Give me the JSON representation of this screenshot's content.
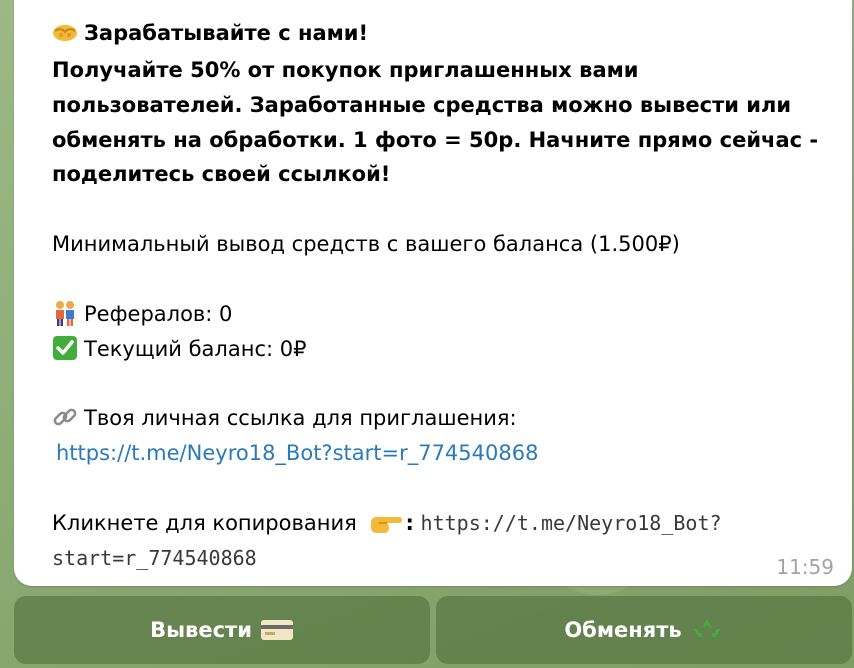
{
  "message": {
    "title": "Зарабатывайте с нами!",
    "intro_lines": [
      "Получайте 50% от покупок приглашенных вами",
      "пользователей. Заработанные средства можно вывести или",
      "обменять на обработки. 1 фото = 50р. Начните прямо сейчас -",
      "поделитесь своей ссылкой!"
    ],
    "min_withdraw": "Минимальный вывод средств с вашего баланса (1.500₽)",
    "referrals": "Рефералов: 0",
    "balance": "Текущий баланс: 0₽",
    "link_label": "Твоя личная ссылка для приглашения:",
    "link_url": "https://t.me/Neyro18_Bot?start=r_774540868",
    "copy_label": "Кликнете для копирования",
    "copy_colon": ":",
    "copy_code_line1": "https://t.me/Neyro18_Bot?",
    "copy_code_line2": "start=r_774540868",
    "time": "11:59"
  },
  "icons": {
    "title": "handshake-icon",
    "referrals": "people-icon",
    "balance": "check-mark-icon",
    "link": "link-icon",
    "copy": "pointing-hand-icon",
    "withdraw": "credit-card-icon",
    "exchange": "recycle-icon"
  },
  "keyboard": {
    "withdraw_label": "Вывести",
    "exchange_label": "Обменять"
  },
  "colors": {
    "link": "#2a7ab8",
    "check_green": "#3fae3a",
    "button_bg": "#4b6937"
  }
}
